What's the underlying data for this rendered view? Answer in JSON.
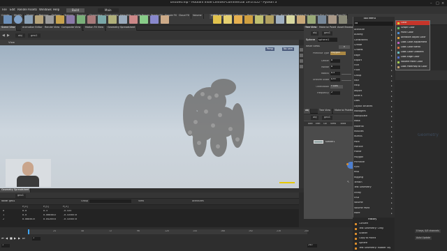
{
  "window": {
    "title": "untitled.hip - Houdini Indie Limited-Commercial 19.0.455 - Python 3"
  },
  "menubar": {
    "items": [
      "File",
      "Edit",
      "Render",
      "Assets",
      "Windows",
      "Help"
    ],
    "desktop": "Build",
    "main_label": "Main"
  },
  "shelf": {
    "tabs": [
      "Create",
      "Modify",
      "Model",
      "Polygon",
      "Deform",
      "Texture",
      "Rigging",
      "Characters",
      "Constraints",
      "Hair Utils",
      "Guide Process",
      "Terrain FX",
      "Simple FX",
      "Cloud FX",
      "Volume"
    ],
    "right_tabs": [
      "Lights and Cameras",
      "Collisions",
      "Particles",
      "Grains",
      "Vellum",
      "Rigid Bodies",
      "Particle Fluids",
      "Viscous Fluids",
      "Oceans",
      "Pyro FX",
      "FEM",
      "Wires",
      "Crowds",
      "Drive Simulation"
    ]
  },
  "left_pane": {
    "tabs": [
      "Scene View",
      "Animation Editor",
      "Render View",
      "Composite View",
      "Motion FX View",
      "Geometry Spreadsheet"
    ],
    "path": [
      "obj",
      "geo1"
    ],
    "view_label": "View",
    "persp": "Persp",
    "cam": "No cam"
  },
  "params": {
    "tabs": [
      "Tree View",
      "Material Palette",
      "Asset Browser"
    ],
    "path": [
      "obj",
      "geo1"
    ],
    "node_type": "Sphere",
    "node_name": "sphere1",
    "reset": "Reset Views",
    "rows": [
      {
        "label": "Primitive Type",
        "value": "Polygon"
      },
      {
        "label": "Center",
        "value": "0"
      },
      {
        "label": "Rotate",
        "value": "0"
      },
      {
        "label": "Radius",
        "value": "0.5"
      },
      {
        "label": "Uniform Scale",
        "value": "0.97"
      },
      {
        "label": "Orientation",
        "value": "Y Axis"
      },
      {
        "label": "Frequency",
        "value": "2"
      }
    ]
  },
  "network": {
    "tabs": [
      "obj",
      "Tree View",
      "Material Palette"
    ],
    "path": [
      "obj",
      "geo1"
    ],
    "menu": [
      "Add",
      "Edit",
      "Go",
      "View",
      "Tools",
      "Layout",
      "Help"
    ],
    "node_label": "scatter1",
    "watermark": "Geometry"
  },
  "tab_menu": {
    "title": "TAB Menu",
    "search": "co",
    "items": [
      "Attribute",
      "Autorig",
      "Constraints",
      "Create",
      "Crowds",
      "Edge",
      "Export",
      "FEM",
      "Fluid",
      "Group",
      "Hair",
      "Help",
      "Import",
      "KineFX",
      "Labs",
      "Layout Brushes",
      "Managers",
      "Manipulate",
      "Mask",
      "Material",
      "Muscles",
      "NURBS",
      "Pack",
      "Particle",
      "Planar",
      "Polygon",
      "Primitive",
      "Pyro",
      "RBD",
      "Rigging",
      "Terrain",
      "Test Geometry",
      "Utility",
      "USD",
      "Volume",
      "Volume Paint",
      "More"
    ],
    "history_title": "History",
    "history": [
      "Convert",
      "Test Geometry: Crag",
      "Scatter",
      "Copy to Points",
      "Sphere",
      "Test Geometry: Rubber Toy"
    ]
  },
  "submenu": {
    "items": [
      "Color",
      "Graph Color",
      "Point Color",
      "Attribute Adjust Color",
      "Labs Color Adjustment",
      "Labs Color Blend",
      "Labs Color Gradient",
      "Labs Edge Color",
      "Volume Paint Color",
      "Labs Pixelmap to Color"
    ]
  },
  "sheet": {
    "node": "geo1",
    "headers": [
      "",
      "P[x]",
      "P[y]",
      "P[z]"
    ],
    "rows": [
      [
        "0",
        "0.0",
        "0.5",
        "-0.435"
      ],
      [
        "1",
        "0.0",
        "0.0085843",
        "-0.4350578"
      ],
      [
        "2",
        "0.0085619",
        "0.0420554",
        "-0.4350578"
      ]
    ],
    "group_label": "Group",
    "view_label": "View",
    "attrs": "Attributes"
  },
  "timeline": {
    "ticks": [
      "24",
      "48",
      "72",
      "96",
      "120",
      "144",
      "168",
      "192",
      "216",
      "240"
    ],
    "frame": "1",
    "start": "1",
    "end": "240",
    "keys": "0 keys, 0/0 channels",
    "auto_update": "Auto Update"
  },
  "colors": {
    "accent": "#d98c2b",
    "viewport_top": "#9fb1c2",
    "viewport_bottom": "#c9d0d6",
    "highlight": "#c7352a",
    "node_blue": "#4d7fd0"
  }
}
